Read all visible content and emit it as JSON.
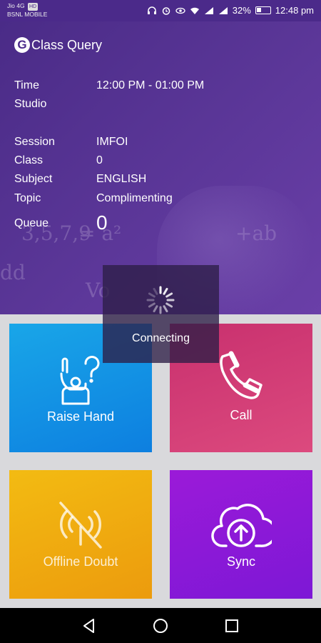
{
  "status_bar": {
    "carrier_line1": "Jio 4G",
    "carrier_badge": "HD",
    "carrier_line2": "BSNL MOBILE",
    "battery_percent": "32%",
    "time": "12:48 pm",
    "icons": [
      "headset-icon",
      "alarm-icon",
      "eye-icon",
      "wifi-icon",
      "signal-icon",
      "signal-icon",
      "battery-icon"
    ]
  },
  "app": {
    "logo_letter": "G",
    "title": "Class Query"
  },
  "info": {
    "time_label": "Time",
    "time_value": "12:00 PM - 01:00 PM",
    "studio_label": "Studio",
    "studio_value": "",
    "session_label": "Session",
    "session_value": "IMFOI",
    "class_label": "Class",
    "class_value": "0",
    "subject_label": "Subject",
    "subject_value": "ENGLISH",
    "topic_label": "Topic",
    "topic_value": "Complimenting",
    "queue_label": "Queue",
    "queue_value": "0"
  },
  "tiles": {
    "raise_hand": "Raise Hand",
    "call": "Call",
    "offline_doubt": "Offline Doubt",
    "sync": "Sync"
  },
  "dialog": {
    "message": "Connecting"
  },
  "colors": {
    "header_purple": "#5a3697",
    "raise_hand_blue": "#0d7fe0",
    "call_pink": "#c8306e",
    "offline_yellow": "#f3bb12",
    "sync_purple": "#8e19d7"
  }
}
